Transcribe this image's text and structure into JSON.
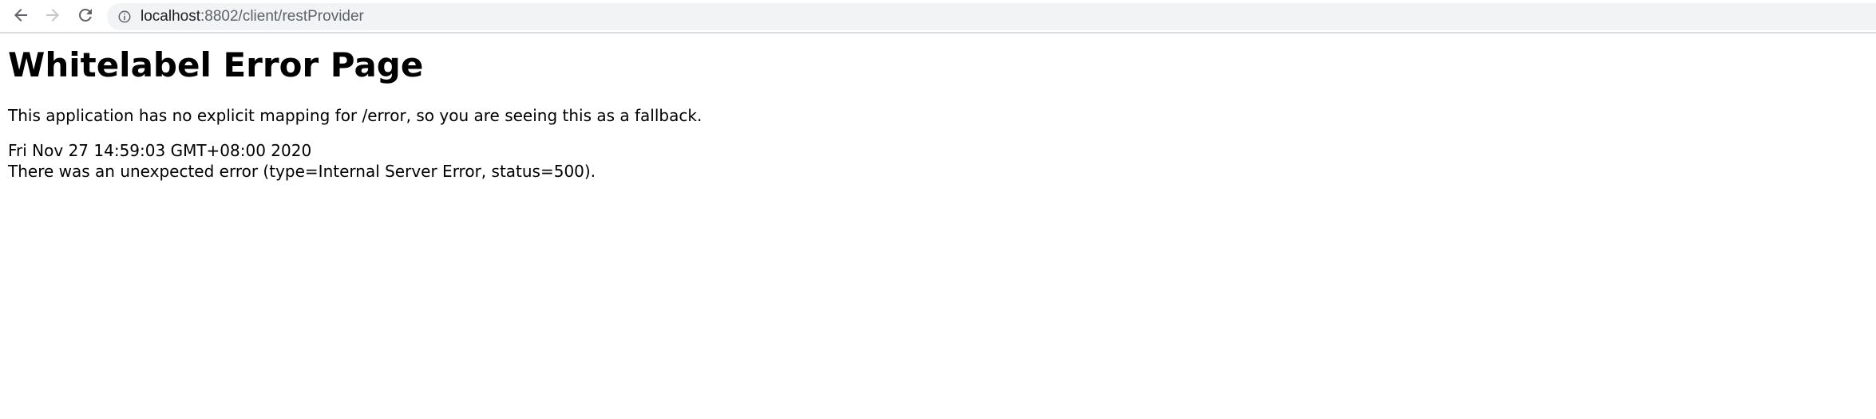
{
  "browser": {
    "url_host": "localhost",
    "url_path": ":8802/client/restProvider",
    "icons": {
      "back": "arrow-left-icon",
      "forward": "arrow-right-icon",
      "reload": "reload-icon",
      "site_info": "info-icon"
    }
  },
  "page": {
    "title": "Whitelabel Error Page",
    "message": "This application has no explicit mapping for /error, so you are seeing this as a fallback.",
    "timestamp": "Fri Nov 27 14:59:03 GMT+08:00 2020",
    "error": "There was an unexpected error (type=Internal Server Error, status=500)."
  }
}
